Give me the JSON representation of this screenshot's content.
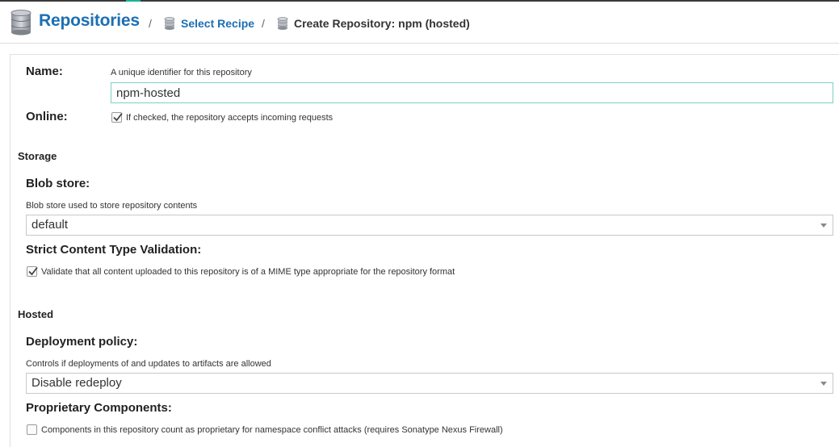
{
  "breadcrumb": {
    "root": "Repositories",
    "separator": "/",
    "step1": "Select Recipe",
    "current": "Create Repository: npm (hosted)"
  },
  "form": {
    "name": {
      "label": "Name:",
      "help": "A unique identifier for this repository",
      "value": "npm-hosted"
    },
    "online": {
      "label": "Online:",
      "checked": true,
      "help": "If checked, the repository accepts incoming requests"
    },
    "storage": {
      "section": "Storage",
      "blob_store": {
        "label": "Blob store:",
        "help": "Blob store used to store repository contents",
        "value": "default"
      },
      "strict_validation": {
        "label": "Strict Content Type Validation:",
        "checked": true,
        "help": "Validate that all content uploaded to this repository is of a MIME type appropriate for the repository format"
      }
    },
    "hosted": {
      "section": "Hosted",
      "deployment_policy": {
        "label": "Deployment policy:",
        "help": "Controls if deployments of and updates to artifacts are allowed",
        "value": "Disable redeploy"
      },
      "proprietary": {
        "label": "Proprietary Components:",
        "checked": false,
        "help": "Components in this repository count as proprietary for namespace conflict attacks (requires Sonatype Nexus Firewall)"
      }
    }
  },
  "colors": {
    "link": "#1c6fb3",
    "accent": "#19b394",
    "focus_border": "#7ccfc0"
  }
}
